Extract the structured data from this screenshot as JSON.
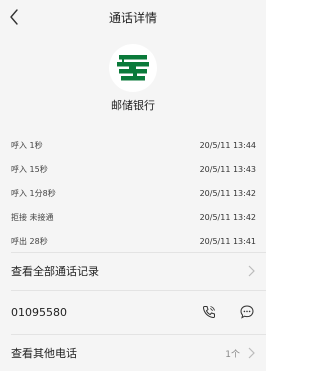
{
  "header": {
    "title": "通话详情"
  },
  "contact": {
    "name": "邮储银行",
    "logo_color": "#0a7a3a"
  },
  "call_log": [
    {
      "type": "呼入 1秒",
      "time": "20/5/11 13:44"
    },
    {
      "type": "呼入 15秒",
      "time": "20/5/11 13:43"
    },
    {
      "type": "呼入 1分8秒",
      "time": "20/5/11 13:42"
    },
    {
      "type": "拒接 未接通",
      "time": "20/5/11 13:42"
    },
    {
      "type": "呼出 28秒",
      "time": "20/5/11 13:41"
    }
  ],
  "all_records": {
    "label": "查看全部通话记录"
  },
  "phone": {
    "number": "01095580"
  },
  "other_phones": {
    "label": "查看其他电话",
    "count": "1个"
  }
}
